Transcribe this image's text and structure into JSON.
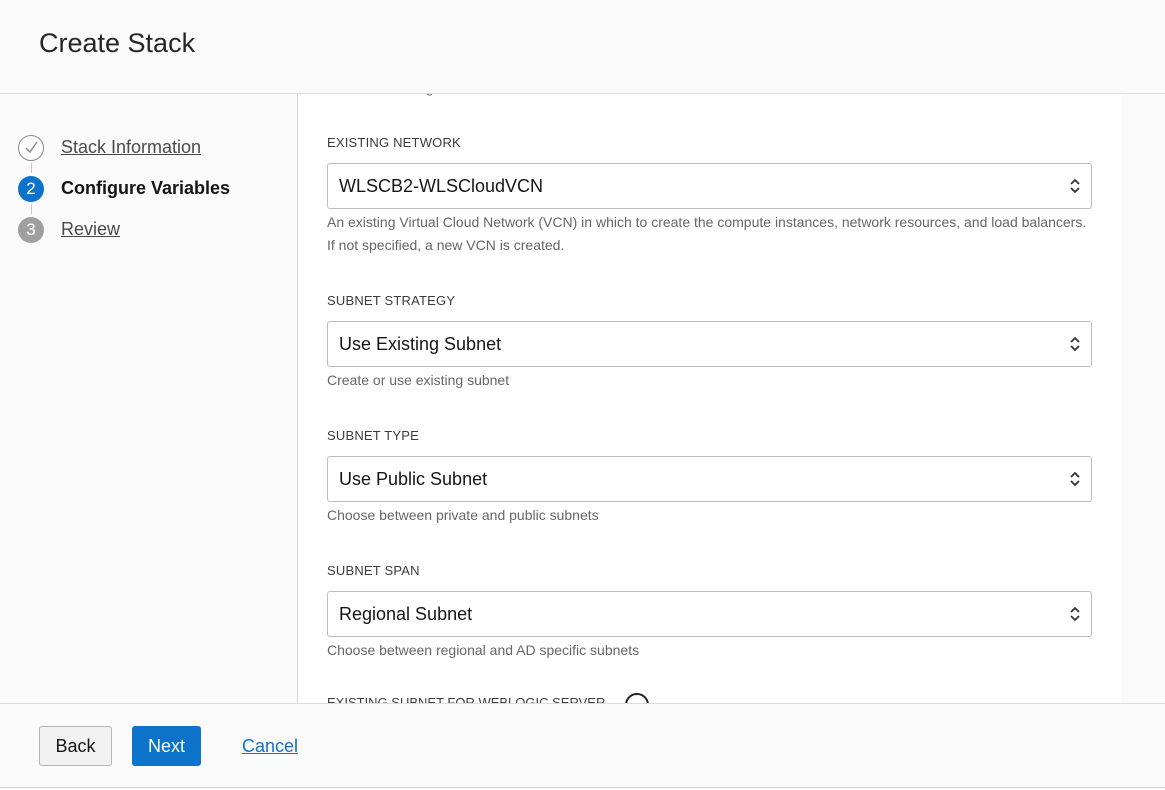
{
  "header": {
    "title": "Create Stack"
  },
  "steps": [
    {
      "number": "",
      "label": "Stack Information",
      "state": "done"
    },
    {
      "number": "2",
      "label": "Configure Variables",
      "state": "active"
    },
    {
      "number": "3",
      "label": "Review",
      "state": "pending"
    }
  ],
  "form": {
    "existing_network": {
      "label": "EXISTING NETWORK",
      "value": "WLSCB2-WLSCloudVCN",
      "help": "An existing Virtual Cloud Network (VCN) in which to create the compute instances, network resources, and load balancers. If not specified, a new VCN is created."
    },
    "subnet_strategy": {
      "label": "SUBNET STRATEGY",
      "value": "Use Existing Subnet",
      "help": "Create or use existing subnet"
    },
    "subnet_type": {
      "label": "SUBNET TYPE",
      "value": "Use Public Subnet",
      "help": "Choose between private and public subnets"
    },
    "subnet_span": {
      "label": "SUBNET SPAN",
      "value": "Regional Subnet",
      "help": "Choose between regional and AD specific subnets"
    },
    "next_label": "EXISTING SUBNET FOR WEBLOGIC SERVER"
  },
  "footer": {
    "back_label": "Back",
    "next_label": "Next",
    "cancel_label": "Cancel"
  },
  "colors": {
    "accent": "#0d72c9",
    "pending": "#9f9f9f"
  },
  "icons": [
    "checkmark-icon",
    "updown-chevron-icon",
    "info-icon"
  ]
}
